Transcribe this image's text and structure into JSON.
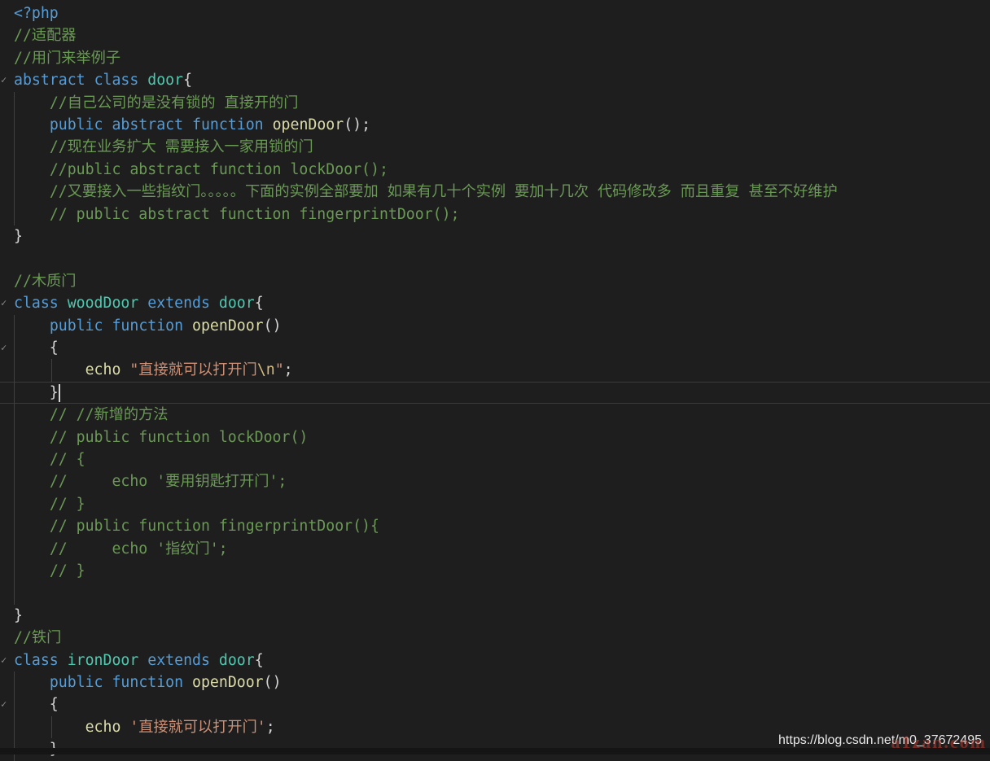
{
  "editor": {
    "lines": [
      [
        [
          "kw",
          "<?php"
        ]
      ],
      [
        [
          "cm",
          "//适配器"
        ]
      ],
      [
        [
          "cm",
          "//用门来举例子"
        ]
      ],
      [
        [
          "kw",
          "abstract "
        ],
        [
          "kw",
          "class "
        ],
        [
          "cls",
          "door"
        ],
        [
          "pl",
          "{"
        ]
      ],
      [
        [
          "pl",
          "    "
        ],
        [
          "cm",
          "//自己公司的是没有锁的 直接开的门"
        ]
      ],
      [
        [
          "pl",
          "    "
        ],
        [
          "kw",
          "public "
        ],
        [
          "kw",
          "abstract "
        ],
        [
          "kw",
          "function "
        ],
        [
          "fn",
          "openDoor"
        ],
        [
          "pl",
          "();"
        ]
      ],
      [
        [
          "pl",
          "    "
        ],
        [
          "cm",
          "//现在业务扩大 需要接入一家用锁的门"
        ]
      ],
      [
        [
          "pl",
          "    "
        ],
        [
          "cm",
          "//public abstract function lockDoor();"
        ]
      ],
      [
        [
          "pl",
          "    "
        ],
        [
          "cm",
          "//又要接入一些指纹门。。。。。下面的实例全部要加 如果有几十个实例 要加十几次 代码修改多 而且重复 甚至不好维护"
        ]
      ],
      [
        [
          "pl",
          "    "
        ],
        [
          "cm",
          "// public abstract function fingerprintDoor();"
        ]
      ],
      [
        [
          "pl",
          "}"
        ]
      ],
      [],
      [
        [
          "cm",
          "//木质门"
        ]
      ],
      [
        [
          "kw",
          "class "
        ],
        [
          "cls",
          "woodDoor "
        ],
        [
          "kw",
          "extends "
        ],
        [
          "cls",
          "door"
        ],
        [
          "pl",
          "{"
        ]
      ],
      [
        [
          "pl",
          "    "
        ],
        [
          "kw",
          "public "
        ],
        [
          "kw",
          "function "
        ],
        [
          "fn",
          "openDoor"
        ],
        [
          "pl",
          "()"
        ]
      ],
      [
        [
          "pl",
          "    {"
        ]
      ],
      [
        [
          "pl",
          "        "
        ],
        [
          "fn",
          "echo "
        ],
        [
          "str",
          "\"直接就可以打开门"
        ],
        [
          "esc",
          "\\n"
        ],
        [
          "str",
          "\""
        ],
        [
          "pl",
          ";"
        ]
      ],
      [
        [
          "pl",
          "    }"
        ]
      ],
      [
        [
          "pl",
          "    "
        ],
        [
          "cm",
          "// //新增的方法"
        ]
      ],
      [
        [
          "pl",
          "    "
        ],
        [
          "cm",
          "// public function lockDoor()"
        ]
      ],
      [
        [
          "pl",
          "    "
        ],
        [
          "cm",
          "// {"
        ]
      ],
      [
        [
          "pl",
          "    "
        ],
        [
          "cm",
          "//     echo '要用钥匙打开门';"
        ]
      ],
      [
        [
          "pl",
          "    "
        ],
        [
          "cm",
          "// }"
        ]
      ],
      [
        [
          "pl",
          "    "
        ],
        [
          "cm",
          "// public function fingerprintDoor(){"
        ]
      ],
      [
        [
          "pl",
          "    "
        ],
        [
          "cm",
          "//     echo '指纹门';"
        ]
      ],
      [
        [
          "pl",
          "    "
        ],
        [
          "cm",
          "// }"
        ]
      ],
      [],
      [
        [
          "pl",
          "}"
        ]
      ],
      [
        [
          "cm",
          "//铁门"
        ]
      ],
      [
        [
          "kw",
          "class "
        ],
        [
          "cls",
          "ironDoor "
        ],
        [
          "kw",
          "extends "
        ],
        [
          "cls",
          "door"
        ],
        [
          "pl",
          "{"
        ]
      ],
      [
        [
          "pl",
          "    "
        ],
        [
          "kw",
          "public "
        ],
        [
          "kw",
          "function "
        ],
        [
          "fn",
          "openDoor"
        ],
        [
          "pl",
          "()"
        ]
      ],
      [
        [
          "pl",
          "    {"
        ]
      ],
      [
        [
          "pl",
          "        "
        ],
        [
          "fn",
          "echo "
        ],
        [
          "str",
          "'直接就可以打开门'"
        ],
        [
          "pl",
          ";"
        ]
      ],
      [
        [
          "pl",
          "    }"
        ]
      ]
    ],
    "fold_marker": "✓",
    "fold_lines": [
      3,
      13,
      15,
      29,
      31
    ],
    "current_line": 17
  },
  "watermark": {
    "text": "https://blog.csdn.net/m0_37672495",
    "overlay": "a1zan.com"
  },
  "colors": {
    "background": "#1e1e1e",
    "keyword": "#569cd6",
    "class_name": "#4ec9b0",
    "function": "#dcdcaa",
    "comment": "#6a9955",
    "string": "#ce9178",
    "escape": "#d7ba7d",
    "plain": "#d4d4d4"
  }
}
